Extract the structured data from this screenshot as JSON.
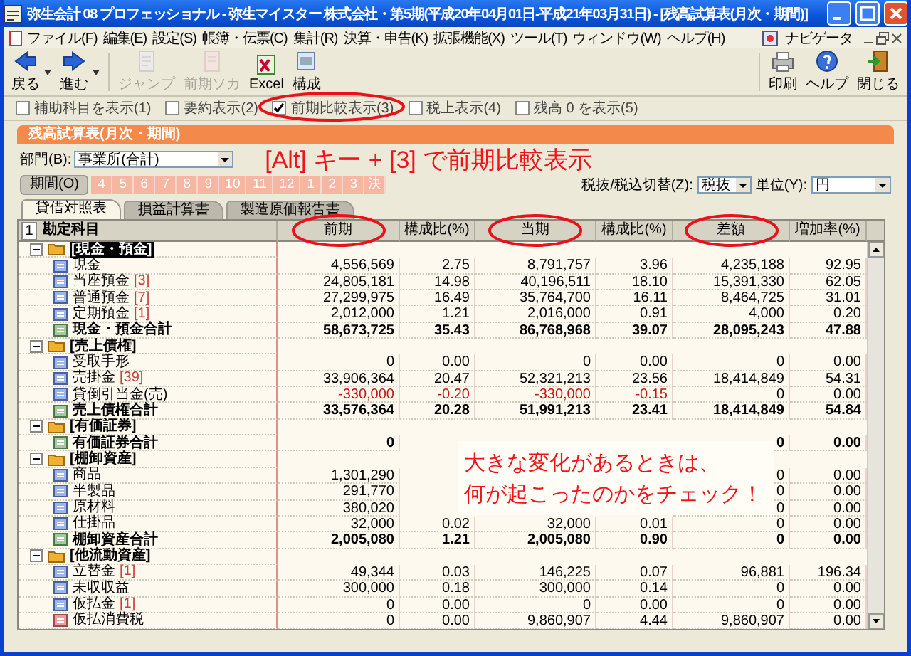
{
  "window": {
    "title": "弥生会計 08 プロフェッショナル - 弥生マイスター 株式会社・第5期(平成20年04月01日-平成21年03月31日) - [残高試算表(月次・期間)]"
  },
  "menu": [
    "ファイル(F)",
    "編集(E)",
    "設定(S)",
    "帳簿・伝票(C)",
    "集計(R)",
    "決算・申告(K)",
    "拡張機能(X)",
    "ツール(T)",
    "ウィンドウ(W)",
    "ヘルプ(H)"
  ],
  "navigator": "ナビゲータ",
  "toolbar": [
    {
      "label": "戻る",
      "kind": "back",
      "disabled": false,
      "dropdown": true
    },
    {
      "label": "進む",
      "kind": "forward",
      "disabled": false,
      "dropdown": true
    },
    {
      "label": "ジャンプ",
      "kind": "jump",
      "disabled": true,
      "dropdown": false
    },
    {
      "label": "前期ソカ",
      "kind": "prior",
      "disabled": true,
      "dropdown": false
    },
    {
      "label": "Excel",
      "kind": "excel",
      "disabled": false,
      "dropdown": false
    },
    {
      "label": "構成",
      "kind": "layout",
      "disabled": false,
      "dropdown": false
    }
  ],
  "toolbar_right": [
    {
      "label": "印刷",
      "kind": "print"
    },
    {
      "label": "ヘルプ",
      "kind": "help"
    },
    {
      "label": "閉じる",
      "kind": "close"
    }
  ],
  "options": [
    {
      "label": "補助科目を表示(1)",
      "checked": false,
      "circled": false
    },
    {
      "label": "要約表示(2)",
      "checked": false,
      "circled": false
    },
    {
      "label": "前期比較表示(3)",
      "checked": true,
      "circled": true
    },
    {
      "label": "税上表示(4)",
      "checked": false,
      "circled": false
    },
    {
      "label": "残高 0 を表示(5)",
      "checked": false,
      "circled": false
    }
  ],
  "report": {
    "title": "残高試算表(月次・期間)",
    "department_label": "部門(B):",
    "department": "事業所(合計)",
    "note": "[Alt] キー + [3] で前期比較表示",
    "period_button": "期間(O)",
    "months": [
      "4",
      "5",
      "6",
      "7",
      "8",
      "9",
      "10",
      "11",
      "12",
      "1",
      "2",
      "3",
      "決"
    ],
    "tax_label": "税抜/税込切替(Z):",
    "tax": "税抜",
    "unit_label": "単位(Y):",
    "unit": "円",
    "tabs": [
      {
        "label": "貸借対照表",
        "selected": true
      },
      {
        "label": "損益計算書",
        "selected": false
      },
      {
        "label": "製造原価報告書",
        "selected": false
      }
    ]
  },
  "table": {
    "index": "1",
    "columns": [
      {
        "label": "勘定科目",
        "circled": false
      },
      {
        "label": "前期",
        "circled": true
      },
      {
        "label": "構成比(%)",
        "circled": false
      },
      {
        "label": "当期",
        "circled": true
      },
      {
        "label": "構成比(%)",
        "circled": false
      },
      {
        "label": "差額",
        "circled": true
      },
      {
        "label": "増加率(%)",
        "circled": false
      }
    ],
    "rows": [
      {
        "kind": "group",
        "name": "[現金・預金]",
        "selected": true
      },
      {
        "kind": "account",
        "name": "現金",
        "cells": [
          "4,556,569",
          "2.75",
          "8,791,757",
          "3.96",
          "4,235,188",
          "92.95"
        ]
      },
      {
        "kind": "account",
        "name": "当座預金",
        "count": "[3]",
        "cells": [
          "24,805,181",
          "14.98",
          "40,196,511",
          "18.10",
          "15,391,330",
          "62.05"
        ]
      },
      {
        "kind": "account",
        "name": "普通預金",
        "count": "[7]",
        "cells": [
          "27,299,975",
          "16.49",
          "35,764,700",
          "16.11",
          "8,464,725",
          "31.01"
        ]
      },
      {
        "kind": "account",
        "name": "定期預金",
        "count": "[1]",
        "cells": [
          "2,012,000",
          "1.21",
          "2,016,000",
          "0.91",
          "4,000",
          "0.20"
        ]
      },
      {
        "kind": "total",
        "name": "現金・預金合計",
        "cells": [
          "58,673,725",
          "35.43",
          "86,768,968",
          "39.07",
          "28,095,243",
          "47.88"
        ]
      },
      {
        "kind": "group",
        "name": "[売上債権]",
        "selected": false
      },
      {
        "kind": "account",
        "name": "受取手形",
        "cells": [
          "0",
          "0.00",
          "0",
          "0.00",
          "0",
          "0.00"
        ]
      },
      {
        "kind": "account",
        "name": "売掛金",
        "count": "[39]",
        "cells": [
          "33,906,364",
          "20.47",
          "52,321,213",
          "23.56",
          "18,414,849",
          "54.31"
        ]
      },
      {
        "kind": "account",
        "name": "貸倒引当金(売)",
        "negative": true,
        "cells": [
          "-330,000",
          "-0.20",
          "-330,000",
          "-0.15",
          "0",
          "0.00"
        ]
      },
      {
        "kind": "total",
        "name": "売上債権合計",
        "cells": [
          "33,576,364",
          "20.28",
          "51,991,213",
          "23.41",
          "18,414,849",
          "54.84"
        ]
      },
      {
        "kind": "group",
        "name": "[有価証券]",
        "selected": false
      },
      {
        "kind": "total",
        "name": "有価証券合計",
        "cells": [
          "0",
          null,
          null,
          null,
          "0",
          "0.00"
        ]
      },
      {
        "kind": "group",
        "name": "[棚卸資産]",
        "selected": false
      },
      {
        "kind": "account",
        "name": "商品",
        "cells": [
          "1,301,290",
          null,
          null,
          null,
          "0",
          "0.00"
        ]
      },
      {
        "kind": "account",
        "name": "半製品",
        "cells": [
          "291,770",
          null,
          null,
          null,
          "0",
          "0.00"
        ]
      },
      {
        "kind": "account",
        "name": "原材料",
        "cells": [
          "380,020",
          null,
          null,
          null,
          "0",
          "0.00"
        ]
      },
      {
        "kind": "account",
        "name": "仕掛品",
        "cells": [
          "32,000",
          "0.02",
          "32,000",
          "0.01",
          "0",
          "0.00"
        ]
      },
      {
        "kind": "total",
        "name": "棚卸資産合計",
        "cells": [
          "2,005,080",
          "1.21",
          "2,005,080",
          "0.90",
          "0",
          "0.00"
        ]
      },
      {
        "kind": "group",
        "name": "[他流動資産]",
        "selected": false
      },
      {
        "kind": "account",
        "name": "立替金",
        "count": "[1]",
        "cells": [
          "49,344",
          "0.03",
          "146,225",
          "0.07",
          "96,881",
          "196.34"
        ]
      },
      {
        "kind": "account",
        "name": "未収収益",
        "cells": [
          "300,000",
          "0.18",
          "300,000",
          "0.14",
          "0",
          "0.00"
        ]
      },
      {
        "kind": "account",
        "name": "仮払金",
        "count": "[1]",
        "cells": [
          "0",
          "0.00",
          "0",
          "0.00",
          "0",
          "0.00"
        ]
      },
      {
        "kind": "tax",
        "name": "仮払消費税",
        "cells": [
          "0",
          "0.00",
          "9,860,907",
          "4.44",
          "9,860,907",
          "0.00"
        ]
      }
    ]
  },
  "callout": {
    "lines": [
      "大きな変化があるときは、",
      "何が起こったのかをチェック！"
    ]
  }
}
